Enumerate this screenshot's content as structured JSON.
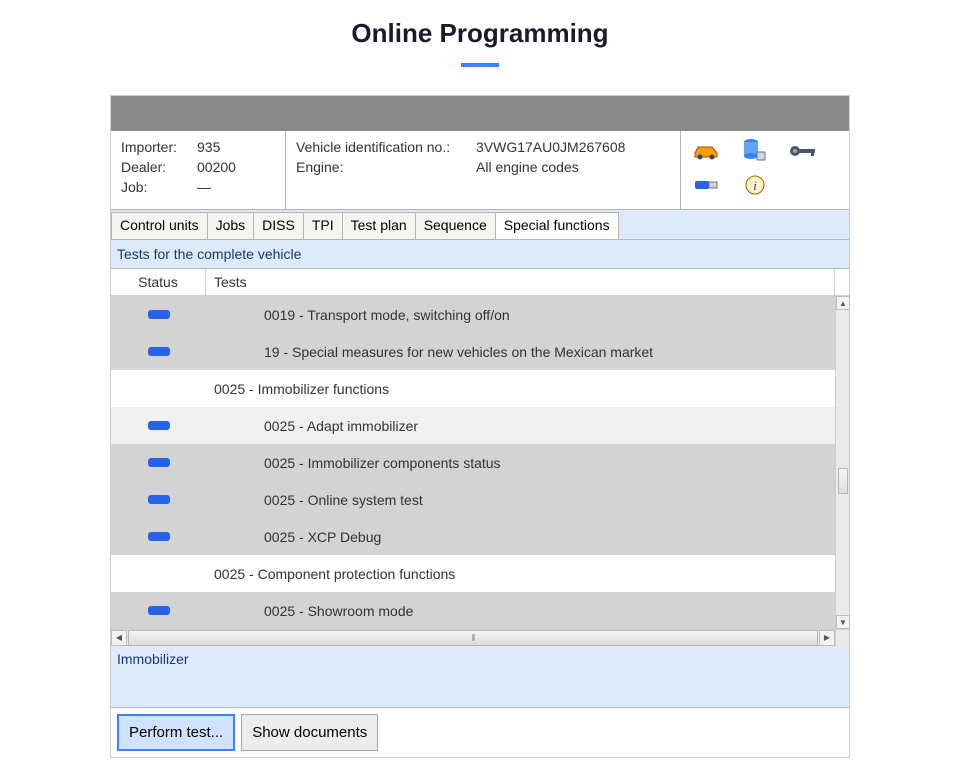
{
  "page": {
    "title": "Online Programming"
  },
  "info": {
    "importer_label": "Importer:",
    "importer_value": "935",
    "dealer_label": "Dealer:",
    "dealer_value": "00200",
    "job_label": "Job:",
    "job_value": "—",
    "vin_label": "Vehicle identification no.:",
    "vin_value": "3VWG17AU0JM267608",
    "engine_label": "Engine:",
    "engine_value": "All engine codes"
  },
  "tabs": [
    {
      "label": "Control units"
    },
    {
      "label": "Jobs"
    },
    {
      "label": "DISS"
    },
    {
      "label": "TPI"
    },
    {
      "label": "Test plan"
    },
    {
      "label": "Sequence"
    },
    {
      "label": "Special functions"
    }
  ],
  "active_tab_index": 6,
  "section_header": "Tests for the complete vehicle",
  "columns": {
    "status": "Status",
    "tests": "Tests"
  },
  "rows": [
    {
      "status": true,
      "indent": true,
      "bg": "grey",
      "label": "0019 - Transport mode, switching off/on"
    },
    {
      "status": true,
      "indent": true,
      "bg": "grey",
      "label": "19 - Special measures for new vehicles on the Mexican market"
    },
    {
      "status": false,
      "indent": false,
      "bg": "white",
      "label": "0025 - Immobilizer functions"
    },
    {
      "status": true,
      "indent": true,
      "bg": "light",
      "label": "0025 - Adapt immobilizer"
    },
    {
      "status": true,
      "indent": true,
      "bg": "grey",
      "label": "0025 - Immobilizer components status"
    },
    {
      "status": true,
      "indent": true,
      "bg": "grey",
      "label": "0025 - Online system test"
    },
    {
      "status": true,
      "indent": true,
      "bg": "grey",
      "label": "0025 - XCP Debug"
    },
    {
      "status": false,
      "indent": false,
      "bg": "white",
      "label": "0025 - Component protection functions"
    },
    {
      "status": true,
      "indent": true,
      "bg": "grey",
      "label": "0025 - Showroom mode"
    }
  ],
  "sub_section": "Immobilizer",
  "actions": {
    "perform": "Perform test...",
    "show_docs": "Show documents"
  },
  "icons": {
    "car": "car-icon",
    "server": "server-icon",
    "key": "key-icon",
    "usb": "usb-icon",
    "info": "info-icon"
  }
}
